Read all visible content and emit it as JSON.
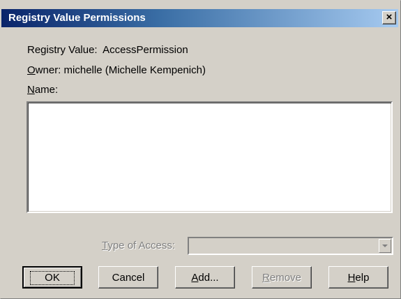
{
  "window": {
    "title": "Registry Value Permissions",
    "close_glyph": "×"
  },
  "info": {
    "registry_value_label": "Registry Value:",
    "registry_value": "AccessPermission",
    "owner_label_prefix": "O",
    "owner_label_rest": "wner:",
    "owner_value": "michelle (Michelle Kempenich)",
    "name_label_prefix": "N",
    "name_label_rest": "ame:"
  },
  "access": {
    "type_label_prefix": "T",
    "type_label_rest": "ype of Access:",
    "selected_value": "",
    "disabled": true
  },
  "buttons": {
    "ok": "OK",
    "cancel": "Cancel",
    "add_prefix": "A",
    "add_rest": "dd...",
    "remove_prefix": "R",
    "remove_rest": "emove",
    "help_prefix": "H",
    "help_rest": "elp"
  },
  "icons": {
    "close": "close-icon",
    "dropdown": "chevron-down-icon"
  },
  "colors": {
    "titlebar_start": "#0a246a",
    "titlebar_end": "#a6caf0",
    "dialog_bg": "#d4d0c8"
  }
}
